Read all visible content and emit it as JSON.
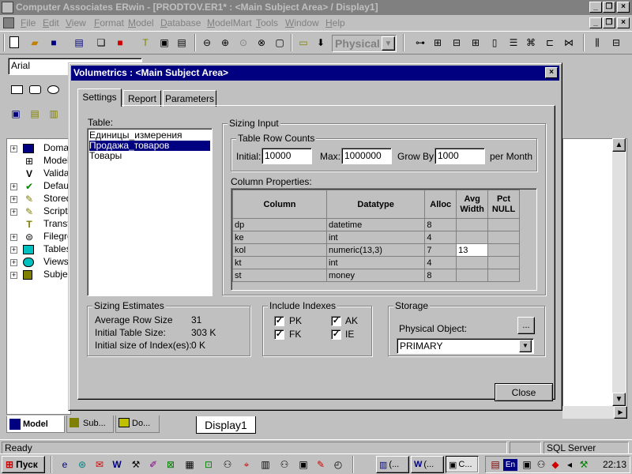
{
  "app": {
    "title": "Computer Associates ERwin - [PRODTOV.ER1* : <Main Subject Area> / Display1]"
  },
  "menu": [
    "File",
    "Edit",
    "View",
    "Format",
    "Model",
    "Database",
    "ModelMart",
    "Tools",
    "Window",
    "Help"
  ],
  "toolbar": {
    "view_mode": "Physical",
    "font_name": "Arial"
  },
  "tree": {
    "items": [
      {
        "label": "Domains"
      },
      {
        "label": "Model S"
      },
      {
        "label": "Validati"
      },
      {
        "label": "Default"
      },
      {
        "label": "Stored"
      },
      {
        "label": "Script T"
      },
      {
        "label": "Transfo"
      },
      {
        "label": "Filegrou"
      },
      {
        "label": "Tables"
      },
      {
        "label": "Views"
      },
      {
        "label": "Subjec"
      }
    ]
  },
  "dialog": {
    "title": "Volumetrics : <Main Subject Area>",
    "tabs": [
      "Settings",
      "Report",
      "Parameters"
    ],
    "active_tab": "Settings",
    "table_label": "Table:",
    "tables": [
      "Единицы_измерения",
      "Продажа_товаров",
      "Товары"
    ],
    "selected_table": "Продажа_товаров",
    "sizing_input_label": "Sizing Input",
    "row_counts": {
      "group_label": "Table Row Counts",
      "initial_label": "Initial:",
      "initial_value": "10000",
      "max_label": "Max:",
      "max_value": "1000000",
      "grow_label": "Grow By:",
      "grow_value": "1000",
      "per_label": "per Month"
    },
    "column_props": {
      "label": "Column Properties:",
      "headers": [
        "Column",
        "Datatype",
        "Alloc",
        "Avg Width",
        "Pct NULL"
      ],
      "rows": [
        {
          "column": "dp",
          "datatype": "datetime",
          "alloc": "8",
          "avg": "",
          "pct": ""
        },
        {
          "column": "ke",
          "datatype": "int",
          "alloc": "4",
          "avg": "",
          "pct": ""
        },
        {
          "column": "kol",
          "datatype": "numeric(13,3)",
          "alloc": "7",
          "avg": "13",
          "pct": ""
        },
        {
          "column": "kt",
          "datatype": "int",
          "alloc": "4",
          "avg": "",
          "pct": ""
        },
        {
          "column": "st",
          "datatype": "money",
          "alloc": "8",
          "avg": "",
          "pct": ""
        }
      ]
    },
    "estimates": {
      "group_label": "Sizing Estimates",
      "avg_row_label": "Average Row Size",
      "avg_row_value": "31",
      "initial_size_label": "Initial Table Size:",
      "initial_size_value": "303 K",
      "index_size_label": "Initial size of Index(es):",
      "index_size_value": "0 K"
    },
    "indexes": {
      "group_label": "Include Indexes",
      "items": [
        {
          "label": "PK",
          "checked": true
        },
        {
          "label": "AK",
          "checked": true
        },
        {
          "label": "FK",
          "checked": true
        },
        {
          "label": "IE",
          "checked": true
        }
      ]
    },
    "storage": {
      "group_label": "Storage",
      "physical_label": "Physical Object:",
      "browse_label": "...",
      "value": "PRIMARY"
    },
    "close_label": "Close"
  },
  "bottom_tabs": [
    "Model",
    "Sub...",
    "Do..."
  ],
  "display_tab": "Display1",
  "status": {
    "left": "Ready",
    "db": "SQL Server"
  },
  "taskbar": {
    "start_label": "Пуск",
    "buttons": [
      "(...",
      "(...",
      "C..."
    ],
    "clock": "22:13",
    "lang": "En"
  }
}
